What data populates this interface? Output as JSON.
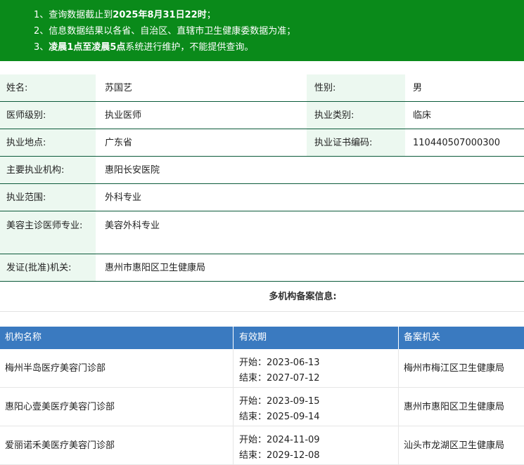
{
  "notice": {
    "line1_prefix": "1、查询数据截止到",
    "line1_bold": "2025年8月31日22时",
    "line1_suffix": "；",
    "line2": "2、信息数据结果以各省、自治区、直辖市卫生健康委数据为准；",
    "line3_prefix": "3、",
    "line3_bold": "凌晨1点至凌晨5点",
    "line3_suffix": "系统进行维护，不能提供查询。"
  },
  "doctor": {
    "name_label": "姓名:",
    "name": "苏国艺",
    "gender_label": "性别:",
    "gender": "男",
    "level_label": "医师级别:",
    "level": "执业医师",
    "category_label": "执业类别:",
    "category": "临床",
    "location_label": "执业地点:",
    "location": "广东省",
    "cert_label": "执业证书编码:",
    "cert": "110440507000300",
    "institution_label": "主要执业机构:",
    "institution": "惠阳长安医院",
    "scope_label": "执业范围:",
    "scope": "外科专业",
    "beauty_label": "美容主诊医师专业:",
    "beauty": "美容外科专业",
    "authority_label": "发证(批准)机关:",
    "authority": "惠州市惠阳区卫生健康局"
  },
  "multi_title": "多机构备案信息:",
  "table": {
    "headers": [
      "机构名称",
      "有效期",
      "备案机关"
    ],
    "rows": [
      {
        "name": "梅州半岛医疗美容门诊部",
        "start": "开始：2023-06-13",
        "end": "结束：2027-07-12",
        "authority": "梅州市梅江区卫生健康局"
      },
      {
        "name": "惠阳心壹美医疗美容门诊部",
        "start": "开始：2023-09-15",
        "end": "结束：2025-09-14",
        "authority": "惠州市惠阳区卫生健康局"
      },
      {
        "name": "爱丽诺禾美医疗美容门诊部",
        "start": "开始：2024-11-09",
        "end": "结束：2029-12-08",
        "authority": "汕头市龙湖区卫生健康局"
      }
    ]
  }
}
